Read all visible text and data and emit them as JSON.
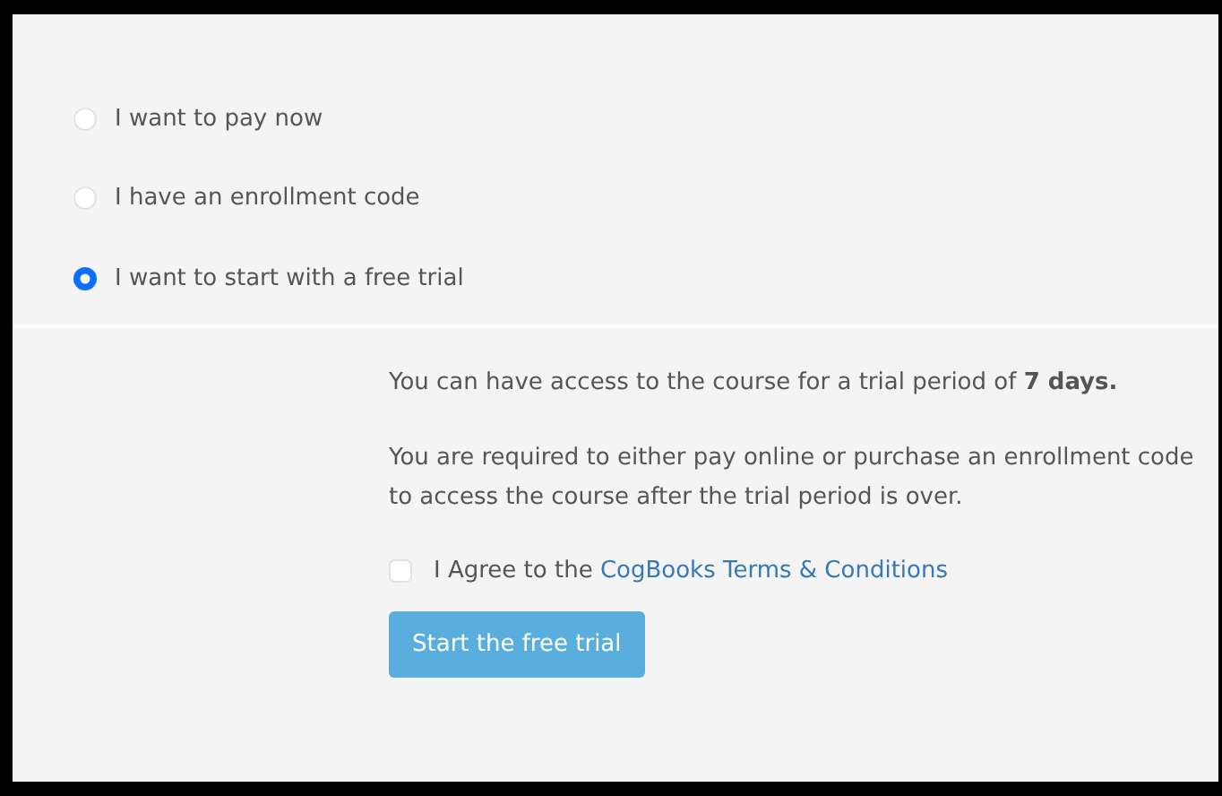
{
  "payment_options": [
    {
      "label": "I want to pay now",
      "selected": false
    },
    {
      "label": "I have an enrollment code",
      "selected": false
    },
    {
      "label": "I want to start with a free trial",
      "selected": true
    }
  ],
  "trial": {
    "notice": "You can have access to the course for a trial period of **7 days.**",
    "requirement": "You are required to either pay online or purchase an enrollment code to access the course after the trial period is over.",
    "agree": {
      "label": "I Agree to the",
      "link": "CogBooks Terms & Conditions",
      "checked": false
    },
    "button": {
      "label": "Start the free trial",
      "disabled": true
    }
  }
}
